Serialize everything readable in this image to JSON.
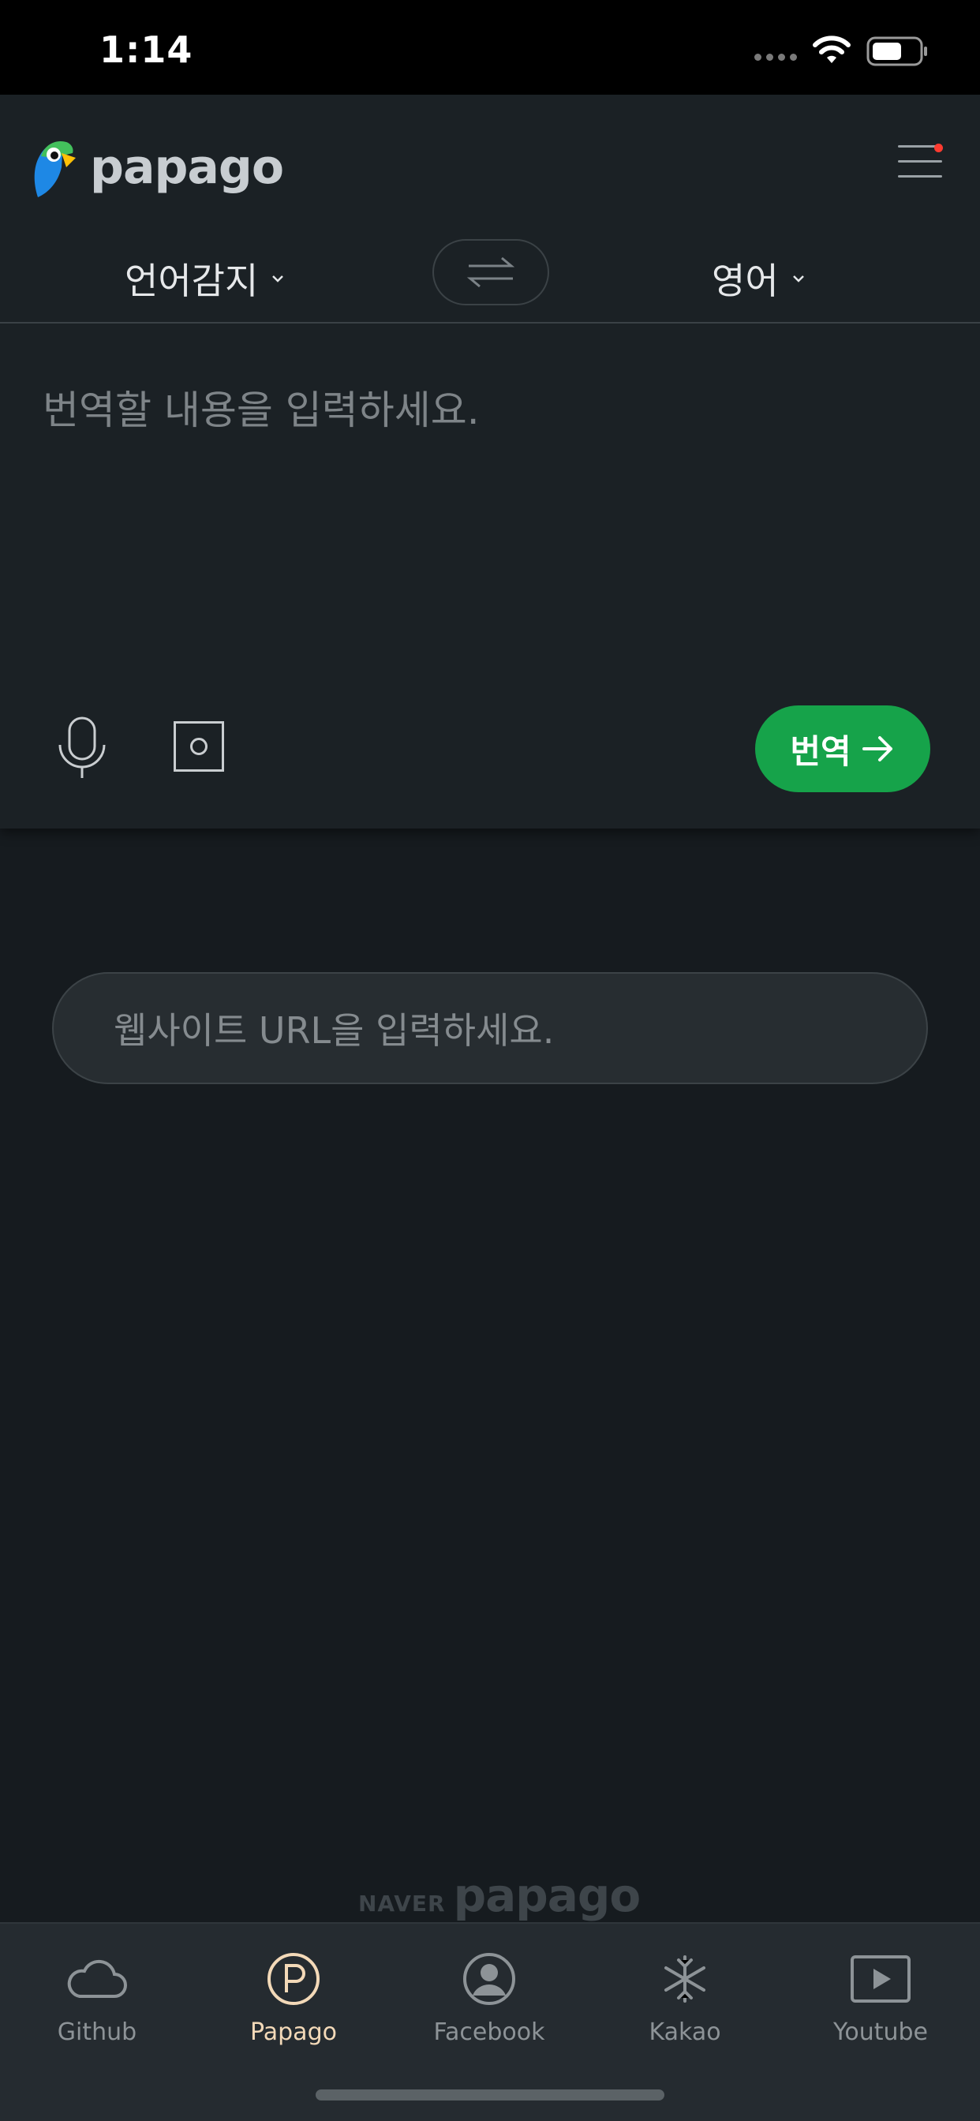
{
  "status_bar": {
    "time": "1:14"
  },
  "header": {
    "logo_text": "papago"
  },
  "languages": {
    "source": "언어감지",
    "target": "영어"
  },
  "input": {
    "placeholder": "번역할 내용을 입력하세요."
  },
  "actions": {
    "translate_label": "번역"
  },
  "website": {
    "placeholder": "웹사이트 URL을 입력하세요."
  },
  "footer": {
    "naver": "NAVER",
    "papago": "papago"
  },
  "tabs": [
    {
      "label": "Github",
      "icon": "cloud-icon"
    },
    {
      "label": "Papago",
      "icon": "papago-p-icon"
    },
    {
      "label": "Facebook",
      "icon": "user-circle-icon"
    },
    {
      "label": "Kakao",
      "icon": "snowflake-icon"
    },
    {
      "label": "Youtube",
      "icon": "play-icon"
    }
  ],
  "colors": {
    "accent": "#16a34a",
    "active_tab": "#f3d9b8",
    "background": "#161b1f"
  }
}
